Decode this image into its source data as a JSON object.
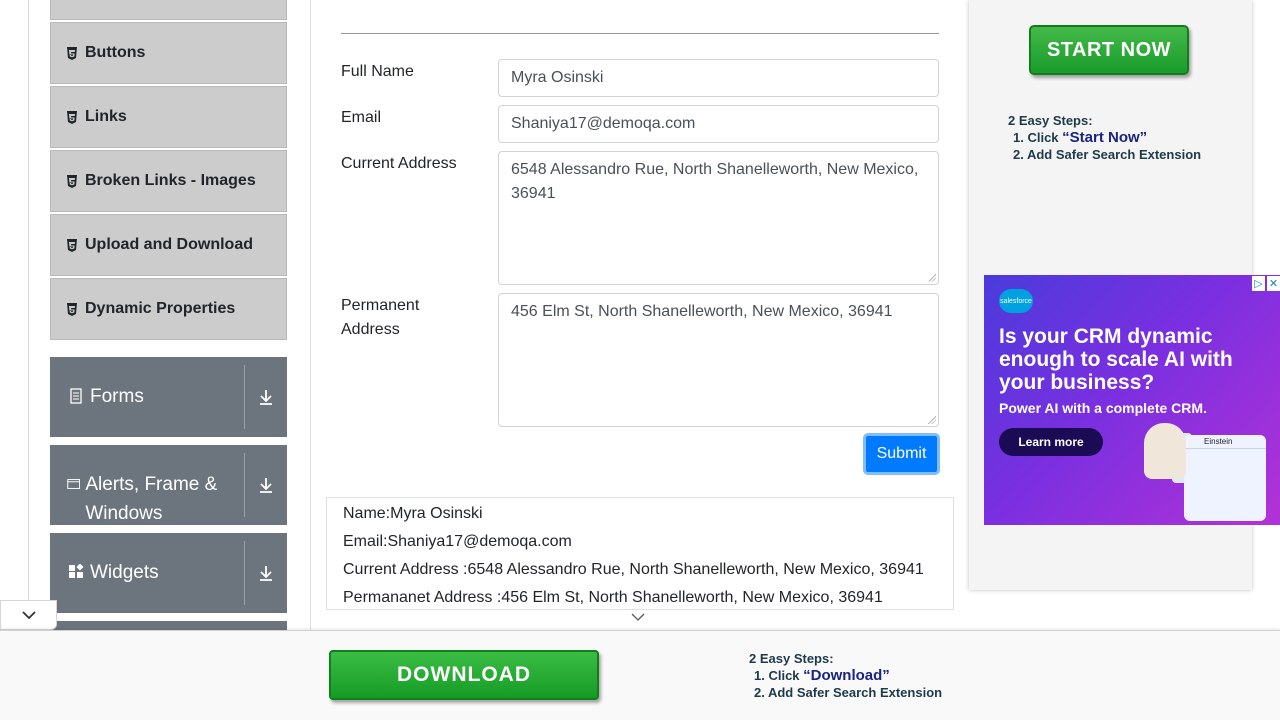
{
  "sidebar": {
    "elements": [
      {
        "label": ""
      },
      {
        "label": "Buttons"
      },
      {
        "label": "Links"
      },
      {
        "label": "Broken Links - Images"
      },
      {
        "label": "Upload and Download"
      },
      {
        "label": "Dynamic Properties"
      }
    ],
    "groups": [
      {
        "label": "Forms"
      },
      {
        "label": "Alerts, Frame & Windows"
      },
      {
        "label": "Widgets"
      }
    ]
  },
  "form": {
    "full_name_label": "Full Name",
    "full_name_value": "Myra Osinski",
    "email_label": "Email",
    "email_value": "Shaniya17@demoqa.com",
    "current_address_label": "Current Address",
    "current_address_value": "6548 Alessandro Rue, North Shanelleworth, New Mexico, 36941",
    "permanent_address_label": "Permanent Address",
    "permanent_address_value": "456 Elm St, North Shanelleworth, New Mexico, 36941",
    "submit_label": "Submit"
  },
  "output": {
    "name": "Name:Myra Osinski",
    "email": "Email:Shaniya17@demoqa.com",
    "current_address": "Current Address :6548 Alessandro Rue, North Shanelleworth, New Mexico, 36941",
    "permanent_address": "Permananet Address :456 Elm St, North Shanelleworth, New Mexico, 36941"
  },
  "ad_top": {
    "button": "START NOW",
    "steps_title": "2 Easy Steps:",
    "step1_prefix": "1. Click ",
    "step1_highlight": "“Start Now”",
    "step2": "2. Add Safer Search Extension"
  },
  "ad_crm": {
    "logo": "salesforce",
    "headline": "Is your CRM dynamic enough to scale AI with your business?",
    "sub": "Power AI with a complete CRM.",
    "cta": "Learn more",
    "card_title": "Einstein"
  },
  "ad_bottom": {
    "button": "DOWNLOAD",
    "steps_title": "2 Easy Steps:",
    "step1_prefix": "1. Click ",
    "step1_highlight": "“Download”",
    "step2": "2. Add Safer Search Extension"
  },
  "colors": {
    "accent": "#007bff",
    "sidebar_item": "#cccccc",
    "group_bg": "#6c757d",
    "ad_green": "#1a9c2a"
  }
}
